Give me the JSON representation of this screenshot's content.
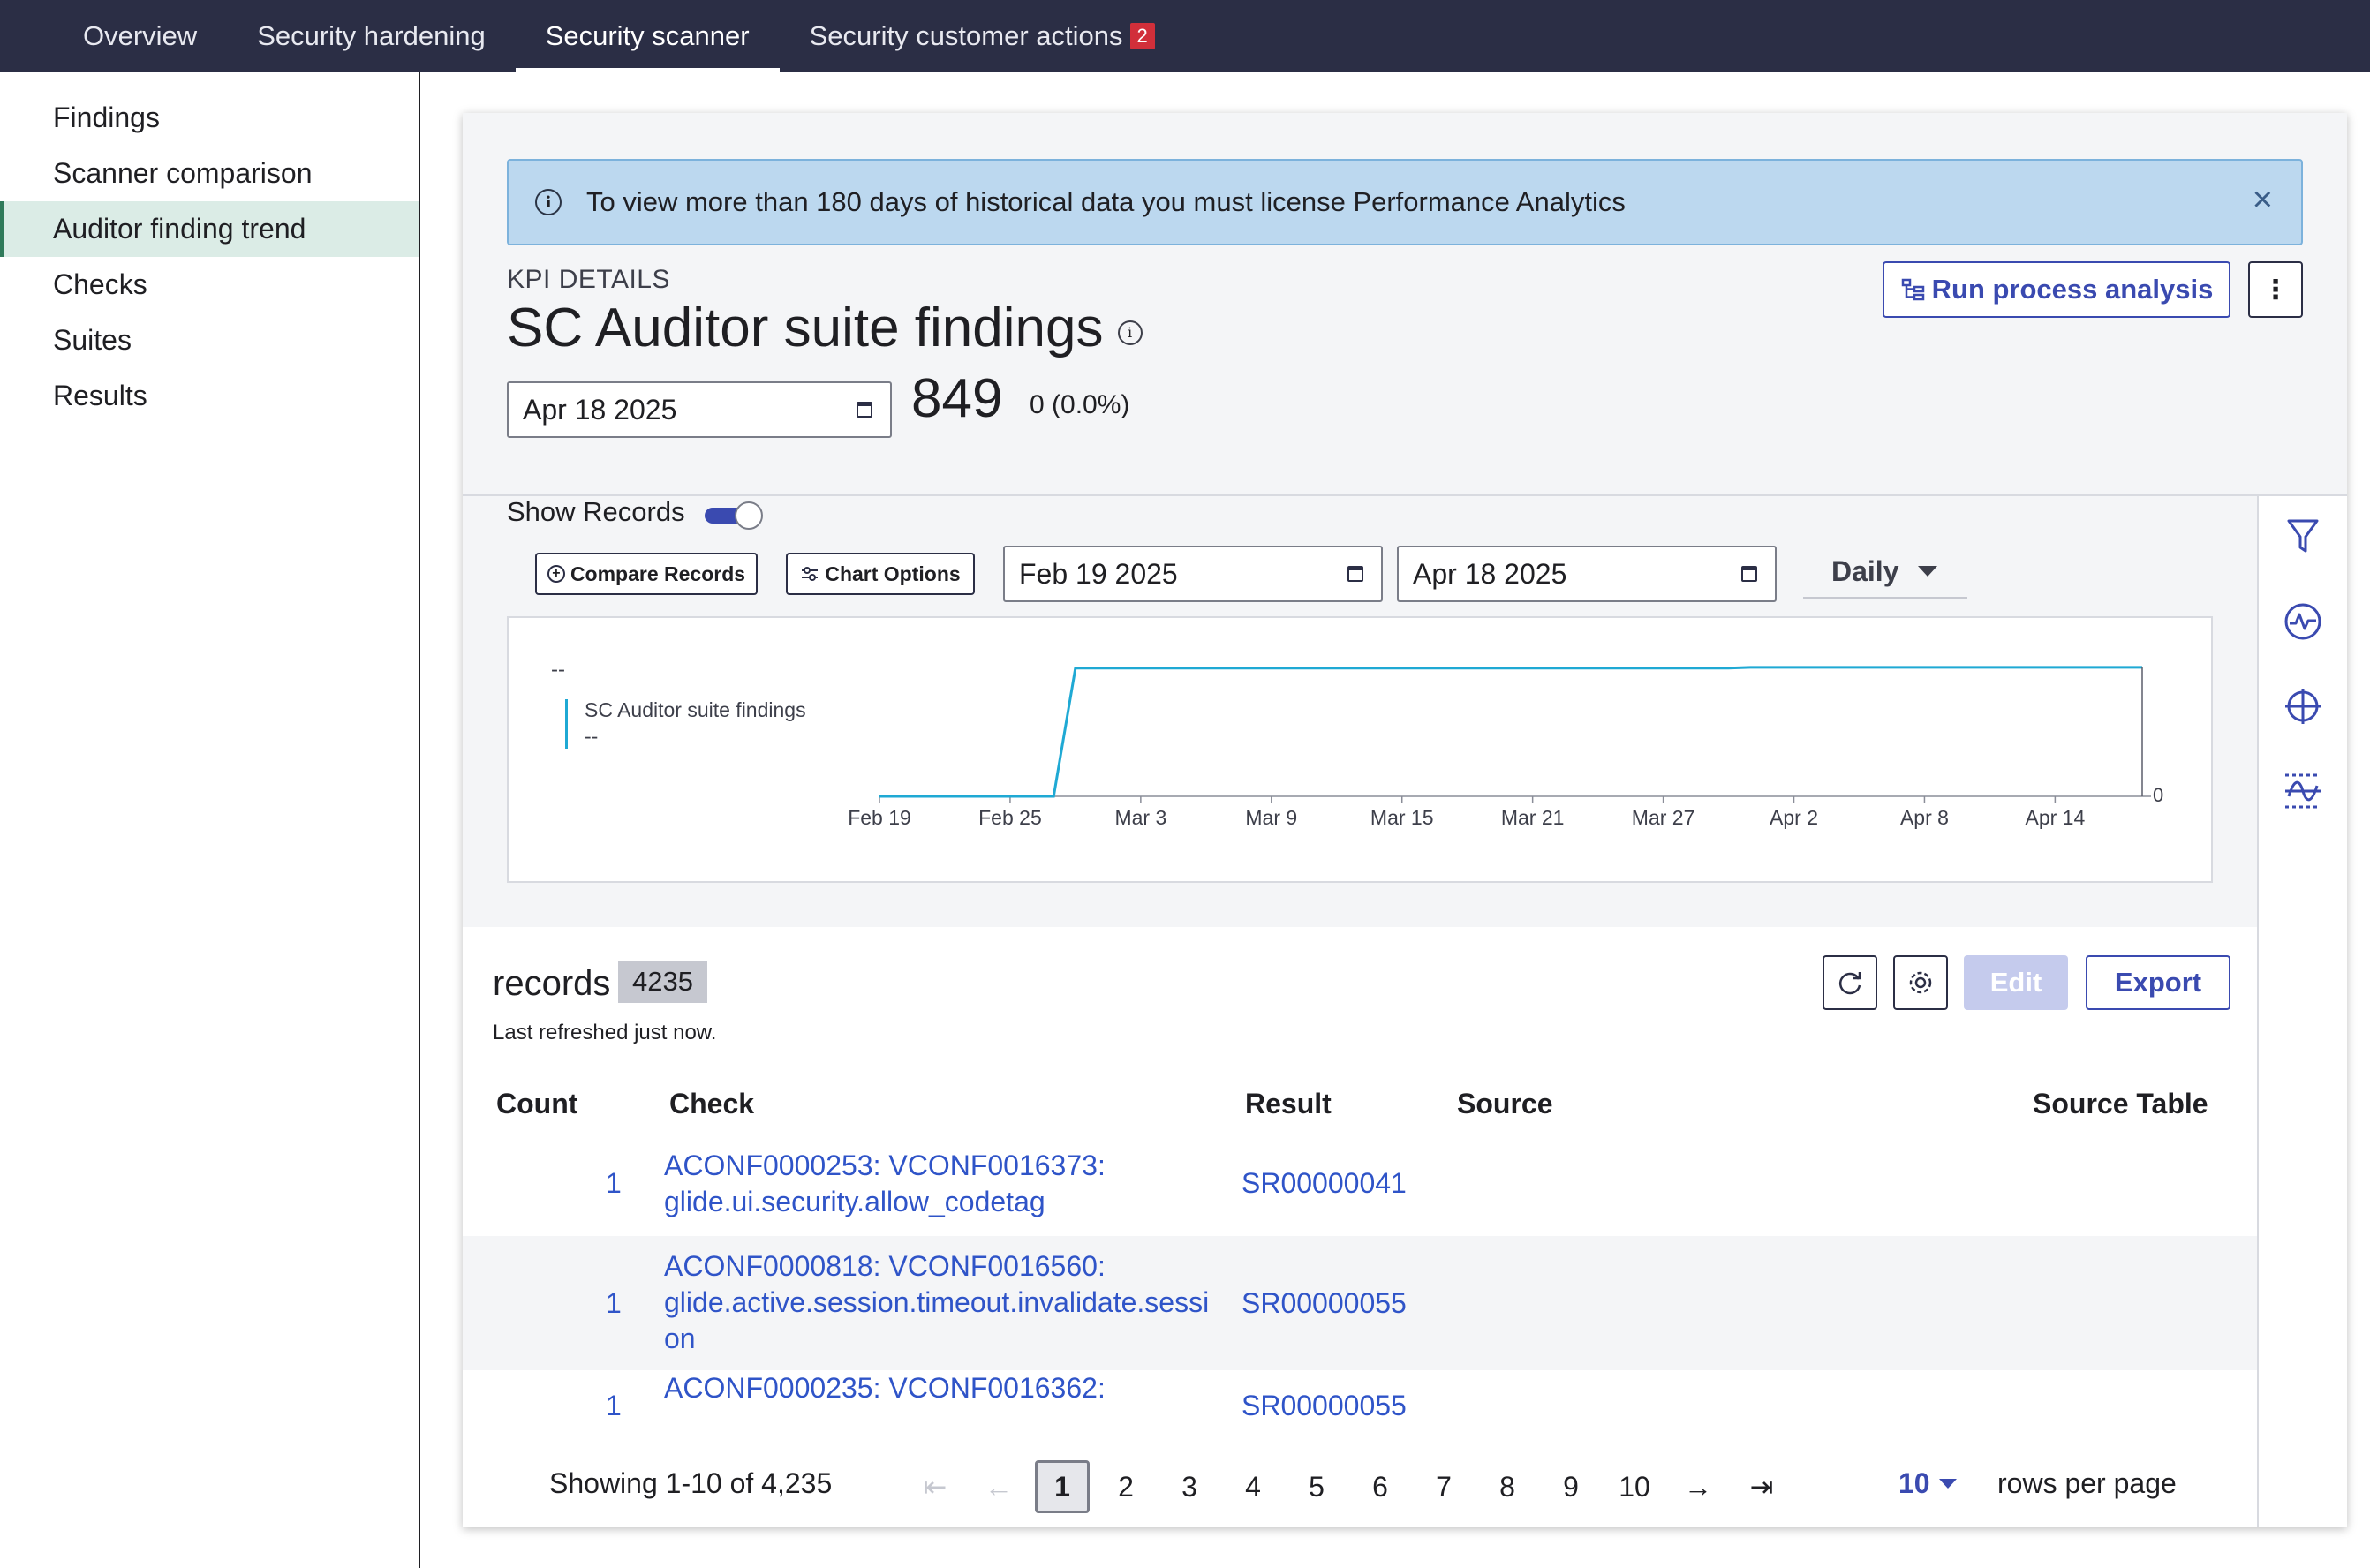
{
  "nav": {
    "tabs": [
      {
        "label": "Overview"
      },
      {
        "label": "Security hardening"
      },
      {
        "label": "Security scanner"
      },
      {
        "label": "Security customer actions",
        "badge": "2"
      }
    ]
  },
  "sidebar": {
    "items": [
      {
        "label": "Findings"
      },
      {
        "label": "Scanner comparison"
      },
      {
        "label": "Auditor finding trend"
      },
      {
        "label": "Checks"
      },
      {
        "label": "Suites"
      },
      {
        "label": "Results"
      }
    ]
  },
  "banner": {
    "text": "To view more than 180 days of historical data you must license Performance Analytics"
  },
  "kpi": {
    "label": "KPI DETAILS",
    "title": "SC Auditor suite findings",
    "date": "Apr 18 2025",
    "value": "849",
    "change": "0 (0.0%)",
    "run_label": "Run process analysis"
  },
  "chart_controls": {
    "show_records_label": "Show Records",
    "show_records_on": true,
    "compare_label": "Compare Records",
    "options_label": "Chart Options",
    "start_date": "Feb 19 2025",
    "end_date": "Apr 18 2025",
    "frequency": "Daily"
  },
  "chart_data": {
    "type": "line",
    "title": "",
    "legend": {
      "name": "SC Auditor suite findings",
      "value": "--"
    },
    "top_label": "--",
    "x_ticks": [
      "Feb 19",
      "Feb 25",
      "Mar 3",
      "Mar 9",
      "Mar 15",
      "Mar 21",
      "Mar 27",
      "Apr 2",
      "Apr 8",
      "Apr 14"
    ],
    "y_right_label": "0",
    "series": [
      {
        "points": [
          {
            "x": "Feb 19",
            "y": 0
          },
          {
            "x": "Feb 27",
            "y": 0
          },
          {
            "x": "Feb 28",
            "y": 844
          },
          {
            "x": "Mar 30",
            "y": 844
          },
          {
            "x": "Mar 31",
            "y": 849
          },
          {
            "x": "Apr 18",
            "y": 849
          }
        ]
      }
    ],
    "color": "#1fa9d4"
  },
  "records": {
    "title": "records",
    "count": "4235",
    "subtitle": "Last refreshed just now.",
    "edit_label": "Edit",
    "export_label": "Export",
    "columns": [
      "Count",
      "Check",
      "Result",
      "Source",
      "Source Table"
    ],
    "rows": [
      {
        "count": "1",
        "check_line1": "ACONF0000253: VCONF0016373:",
        "check_line2": "glide.ui.security.allow_codetag",
        "check_line3": "",
        "result": "SR00000041"
      },
      {
        "count": "1",
        "check_line1": "ACONF0000818: VCONF0016560:",
        "check_line2": "glide.active.session.timeout.invalidate.sessi",
        "check_line3": "on",
        "result": "SR00000055"
      },
      {
        "count": "1",
        "check_line1": "ACONF0000235: VCONF0016362:",
        "check_line2": "",
        "check_line3": "",
        "result": "SR00000055"
      }
    ]
  },
  "pager": {
    "showing": "Showing 1-10 of 4,235",
    "pages": [
      "1",
      "2",
      "3",
      "4",
      "5",
      "6",
      "7",
      "8",
      "9",
      "10"
    ],
    "current": "1",
    "rows_per_page": "10",
    "rows_label": "rows per page"
  }
}
